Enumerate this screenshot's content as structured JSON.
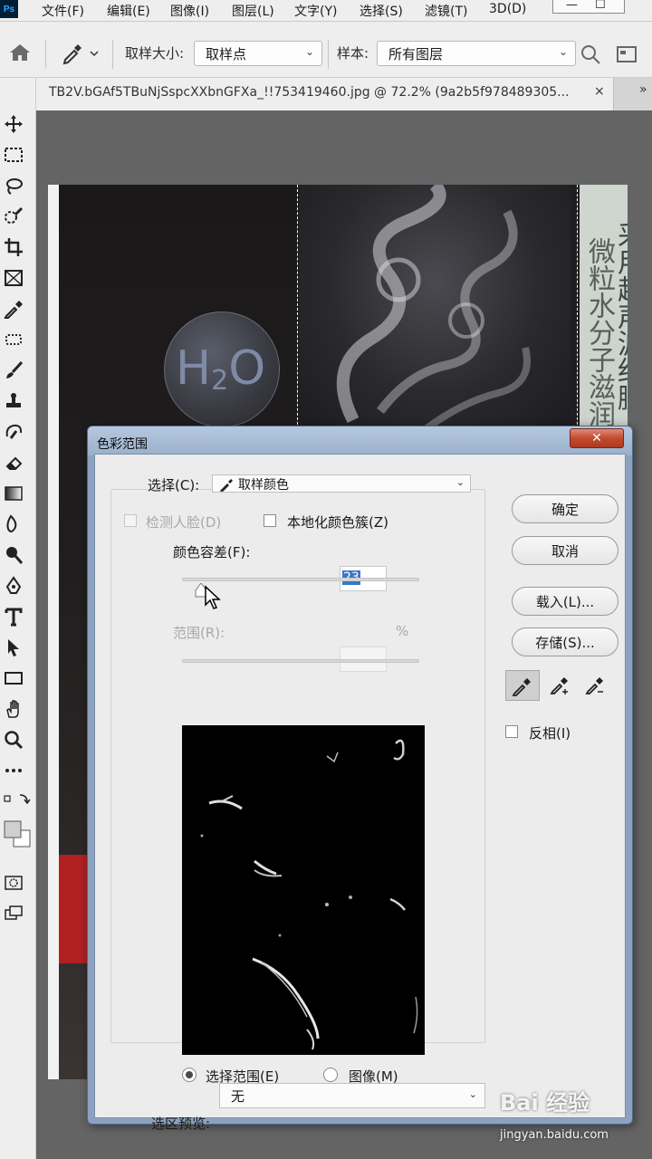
{
  "app": {
    "logo": "Ps"
  },
  "menu": [
    "文件(F)",
    "编辑(E)",
    "图像(I)",
    "图层(L)",
    "文字(Y)",
    "选择(S)",
    "滤镜(T)",
    "3D(D)"
  ],
  "options_bar": {
    "sample_size_label": "取样大小:",
    "sample_size_value": "取样点",
    "sample_label": "样本:",
    "sample_value": "所有图层"
  },
  "document_tab": {
    "title": "TB2V.bGAf5TBuNjSspcXXbnGFXa_!!753419460.jpg @ 72.2% (9a2b5f978489305...",
    "close": "×",
    "overflow": "»"
  },
  "image_content": {
    "h2o_main": "H",
    "h2o_sub": "2",
    "h2o_end": "O",
    "vertical_text_1": "微粒水分子滋润",
    "vertical_text_2": "采用超声波细腻"
  },
  "dialog": {
    "title": "色彩范围",
    "close": "✕",
    "select_label": "选择(C):",
    "select_value": "取样颜色",
    "detect_faces_label": "检测人脸(D)",
    "localized_label": "本地化颜色簇(Z)",
    "fuzziness_label": "颜色容差(F):",
    "fuzziness_value": "23",
    "fuzziness": 0.08,
    "range_label": "范围(R):",
    "range_unit": "%",
    "radio_selection_label": "选择范围(E)",
    "radio_image_label": "图像(M)",
    "selection_preview_label": "选区预览:",
    "selection_preview_value": "无",
    "ok_label": "确定",
    "cancel_label": "取消",
    "load_label": "载入(L)...",
    "save_label": "存储(S)...",
    "invert_label": "反相(I)"
  },
  "watermark": {
    "brand": "Bai 经验",
    "url": "jingyan.baidu.com"
  }
}
